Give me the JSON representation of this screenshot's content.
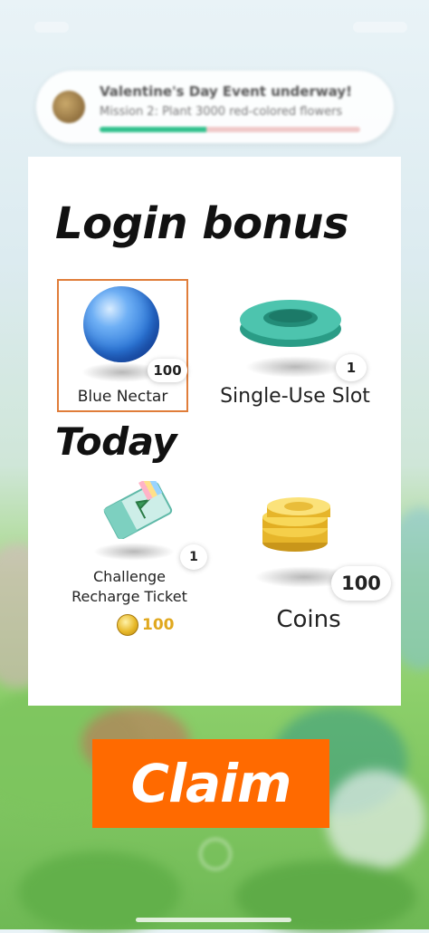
{
  "event": {
    "title": "Valentine's Day Event underway!",
    "subtitle": "Mission 2: Plant 3000 red-colored flowers",
    "progress": 0.41
  },
  "card": {
    "heading": "Login bonus",
    "subheading": "Today",
    "rewards": [
      {
        "name": "Blue Nectar",
        "count": "100",
        "icon": "blue-nectar-icon",
        "selected": true
      },
      {
        "name": "Single-Use Slot",
        "count": "1",
        "icon": "slot-icon"
      },
      {
        "name_line1": "Challenge",
        "name_line2": "Recharge Ticket",
        "count": "1",
        "icon": "ticket-icon",
        "cost": "100"
      },
      {
        "name": "Coins",
        "count": "100",
        "icon": "coins-icon"
      }
    ]
  },
  "claim_label": "Claim",
  "colors": {
    "accent": "#ff6a00",
    "selection": "#e07d3a",
    "progress": "#2fc08c"
  }
}
